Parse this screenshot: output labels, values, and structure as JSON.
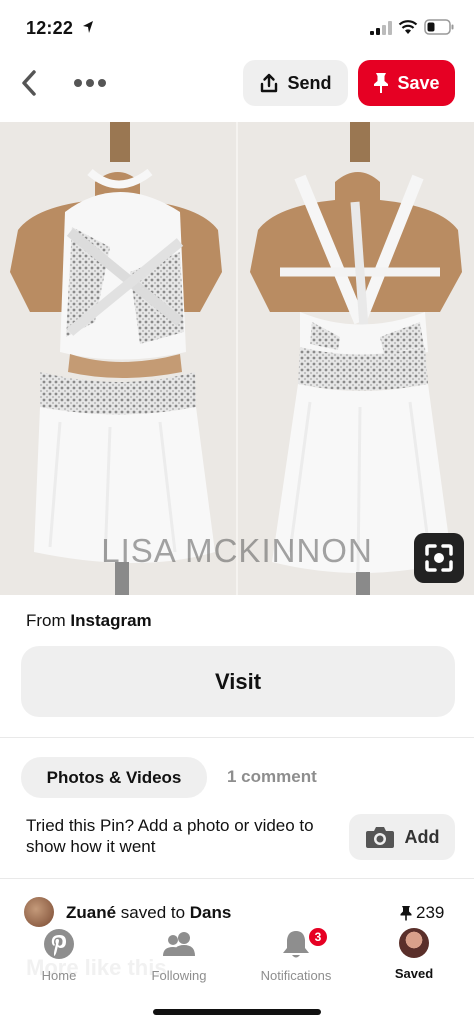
{
  "status_bar": {
    "time": "12:22"
  },
  "nav": {
    "send_label": "Send",
    "save_label": "Save"
  },
  "pin": {
    "watermark": "LISA MCKINNON"
  },
  "source": {
    "prefix": "From ",
    "name": "Instagram"
  },
  "visit_label": "Visit",
  "tabs": {
    "photos_label": "Photos & Videos",
    "comments_label": "1 comment"
  },
  "tried": {
    "text": "Tried this Pin? Add a photo or video to show how it went",
    "add_label": "Add"
  },
  "saved": {
    "user": "Zuané",
    "middle": " saved to ",
    "board": "Dans",
    "count": "239"
  },
  "more_like_this": "More like this",
  "bottom_nav": {
    "home": "Home",
    "following": "Following",
    "notifications": "Notifications",
    "notifications_badge": "3",
    "saved": "Saved"
  },
  "colors": {
    "brand": "#e60023",
    "button_bg": "#efefef",
    "muted": "#8e8e8e"
  }
}
